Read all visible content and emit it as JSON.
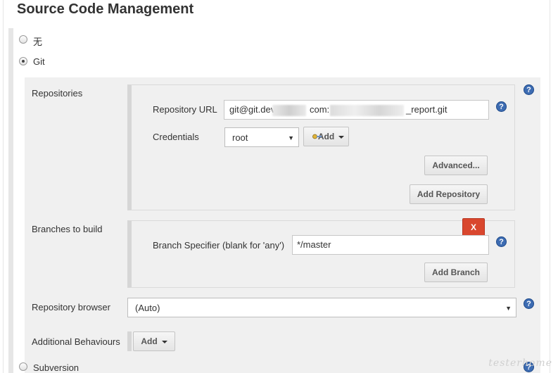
{
  "section": {
    "title": "Source Code Management"
  },
  "scm_options": {
    "none_label": "无",
    "git_label": "Git",
    "subversion_label": "Subversion"
  },
  "repositories": {
    "label": "Repositories",
    "repository_url_label": "Repository URL",
    "repository_url_prefix": "git@git.dev",
    "repository_url_mid": "com:",
    "repository_url_suffix": "_report.git",
    "credentials_label": "Credentials",
    "credentials_value": "root",
    "add_credentials_label": "Add",
    "advanced_label": "Advanced...",
    "add_repository_label": "Add Repository"
  },
  "branches": {
    "label": "Branches to build",
    "delete_label": "X",
    "specifier_label": "Branch Specifier (blank for 'any')",
    "specifier_value": "*/master",
    "add_branch_label": "Add Branch"
  },
  "repository_browser": {
    "label": "Repository browser",
    "value": "(Auto)"
  },
  "additional_behaviours": {
    "label": "Additional Behaviours",
    "add_label": "Add"
  },
  "help_icon_glyph": "?",
  "dropdown_arrow_glyph": "▼",
  "watermark": "testerhome",
  "colors": {
    "help_icon": "#3d6cb2",
    "delete_button": "#d9472e",
    "panel_bg": "#f0f0f0"
  }
}
